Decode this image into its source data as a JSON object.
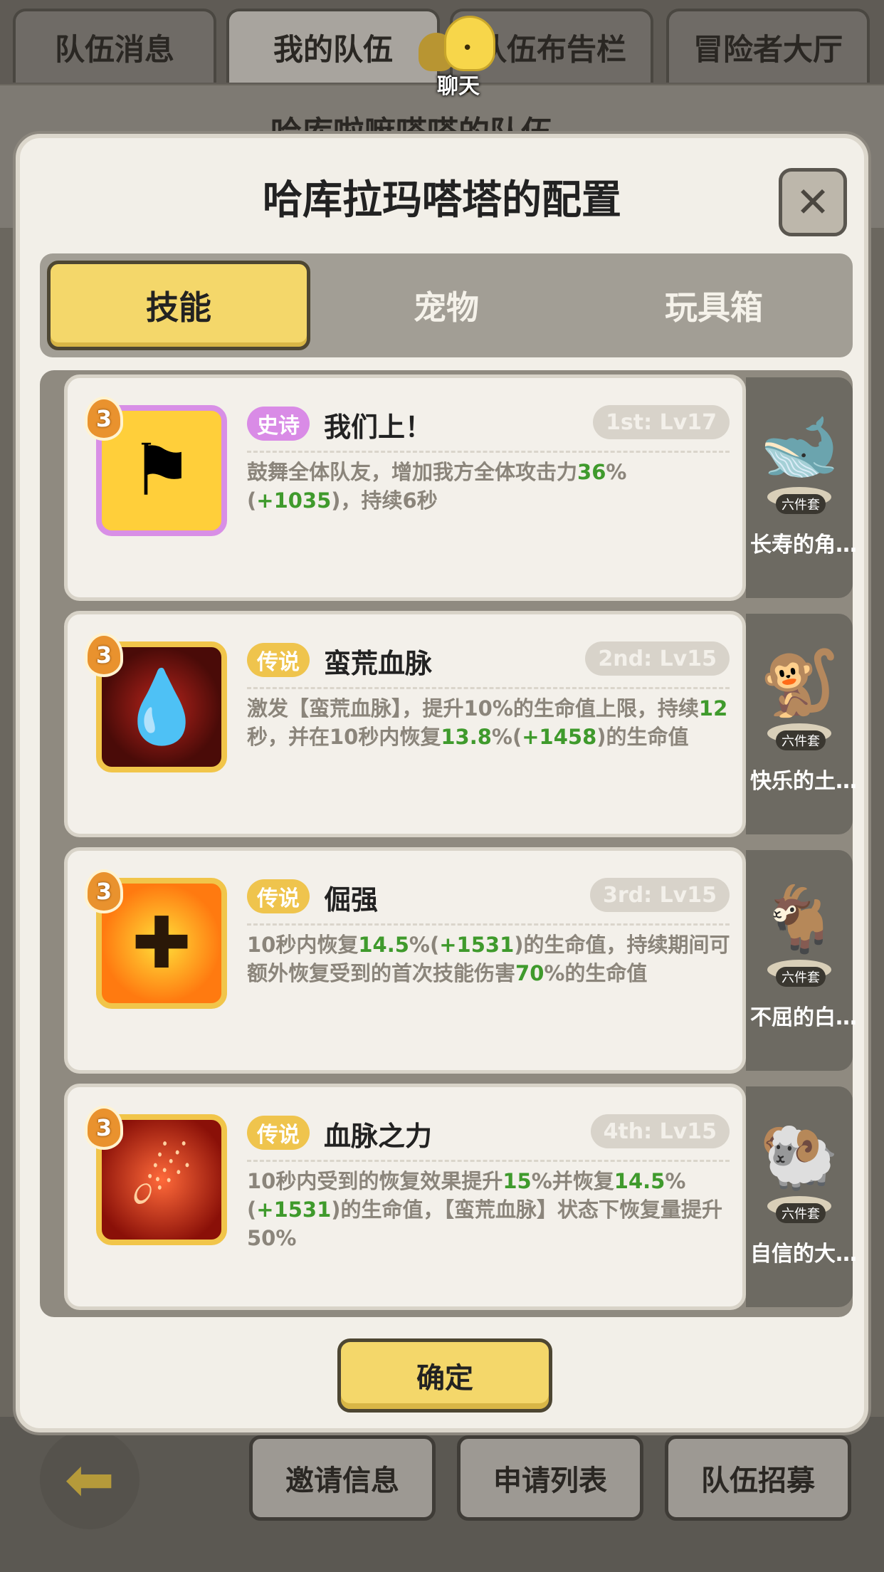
{
  "top_tabs": [
    "队伍消息",
    "我的队伍",
    "队伍布告栏",
    "冒险者大厅"
  ],
  "chat_label": "聊天",
  "background_title": "哈库啦嘛嗒嗒的队伍",
  "modal": {
    "title": "哈库拉玛嗒塔的配置",
    "close_icon": "close-icon",
    "tabs": [
      "技能",
      "宠物",
      "玩具箱"
    ],
    "active_tab": "技能",
    "confirm_label": "确定"
  },
  "skills": [
    {
      "badge": "3",
      "rarity": "史诗",
      "name": "我们上！",
      "order": "1st: Lv17",
      "desc": [
        {
          "t": "鼓舞全体队友，增加我方全体攻击力",
          "g": false
        },
        {
          "t": "36",
          "g": true
        },
        {
          "t": "%(",
          "g": false
        },
        {
          "t": "+1035",
          "g": true
        },
        {
          "t": ")，持续6秒",
          "g": false
        }
      ]
    },
    {
      "badge": "3",
      "rarity": "传说",
      "name": "蛮荒血脉",
      "order": "2nd: Lv15",
      "desc": [
        {
          "t": "激发【蛮荒血脉】，提升10%的生命值上限，持续",
          "g": false
        },
        {
          "t": "12",
          "g": true
        },
        {
          "t": "秒，并在10秒内恢复",
          "g": false
        },
        {
          "t": "13.8",
          "g": true
        },
        {
          "t": "%(",
          "g": false
        },
        {
          "t": "+1458",
          "g": true
        },
        {
          "t": ")的生命值",
          "g": false
        }
      ]
    },
    {
      "badge": "3",
      "rarity": "传说",
      "name": "倔强",
      "order": "3rd: Lv15",
      "desc": [
        {
          "t": "10秒内恢复",
          "g": false
        },
        {
          "t": "14.5",
          "g": true
        },
        {
          "t": "%(",
          "g": false
        },
        {
          "t": "+1531",
          "g": true
        },
        {
          "t": ")的生命值，持续期间可额外恢复受到的首次技能伤害",
          "g": false
        },
        {
          "t": "70",
          "g": true
        },
        {
          "t": "%的生命值",
          "g": false
        }
      ]
    },
    {
      "badge": "3",
      "rarity": "传说",
      "name": "血脉之力",
      "order": "4th: Lv15",
      "desc": [
        {
          "t": "10秒内受到的恢复效果提升",
          "g": false
        },
        {
          "t": "15",
          "g": true
        },
        {
          "t": "%并恢复",
          "g": false
        },
        {
          "t": "14.5",
          "g": true
        },
        {
          "t": "%(",
          "g": false
        },
        {
          "t": "+1531",
          "g": true
        },
        {
          "t": ")的生命值，【蛮荒血脉】状态下恢复量提升50%",
          "g": false
        }
      ]
    }
  ],
  "pets": [
    {
      "name": "长寿的角…",
      "set": "六件套",
      "icon": "whale-pet-icon"
    },
    {
      "name": "快乐的土…",
      "set": "六件套",
      "icon": "monkey-pet-icon"
    },
    {
      "name": "不屈的白…",
      "set": "六件套",
      "icon": "goat-pet-icon"
    },
    {
      "name": "自信的大…",
      "set": "六件套",
      "icon": "dark-goat-pet-icon"
    }
  ],
  "bottom_buttons": [
    "邀请信息",
    "申请列表",
    "队伍招募"
  ],
  "colors": {
    "accent_yellow": "#f4d76a",
    "epic_purple": "#d98be6",
    "legend_gold": "#efc44d",
    "value_green": "#3f9a2c"
  }
}
